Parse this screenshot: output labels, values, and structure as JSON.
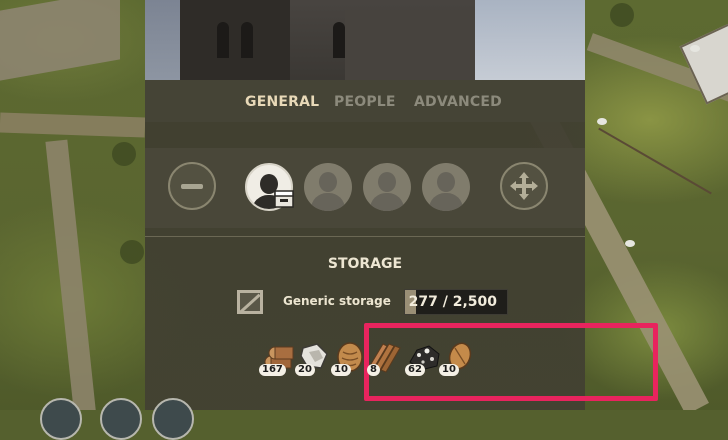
{
  "tabs": [
    {
      "label": "GENERAL",
      "active": true
    },
    {
      "label": "PEOPLE",
      "active": false
    },
    {
      "label": "ADVANCED",
      "active": false
    }
  ],
  "workers": {
    "slots": [
      "filled",
      "empty",
      "empty",
      "empty"
    ],
    "remove_icon": "minus-icon",
    "add_icon": "move-cross-icon"
  },
  "storage": {
    "title": "STORAGE",
    "type_label": "Generic storage",
    "capacity": "277 / 2,500",
    "fill_fraction": 0.11
  },
  "resources": [
    {
      "icon": "logs-icon",
      "count": "167"
    },
    {
      "icon": "stone-icon",
      "count": "20"
    },
    {
      "icon": "nut-icon",
      "count": "10"
    },
    {
      "icon": "planks-icon",
      "count": "8"
    },
    {
      "icon": "iron-ore-icon",
      "count": "62"
    },
    {
      "icon": "seed-icon",
      "count": "10"
    }
  ],
  "colors": {
    "highlight": "#e8245e",
    "active_tab": "#e8d9b8",
    "inactive_tab": "#8c8a7c"
  }
}
